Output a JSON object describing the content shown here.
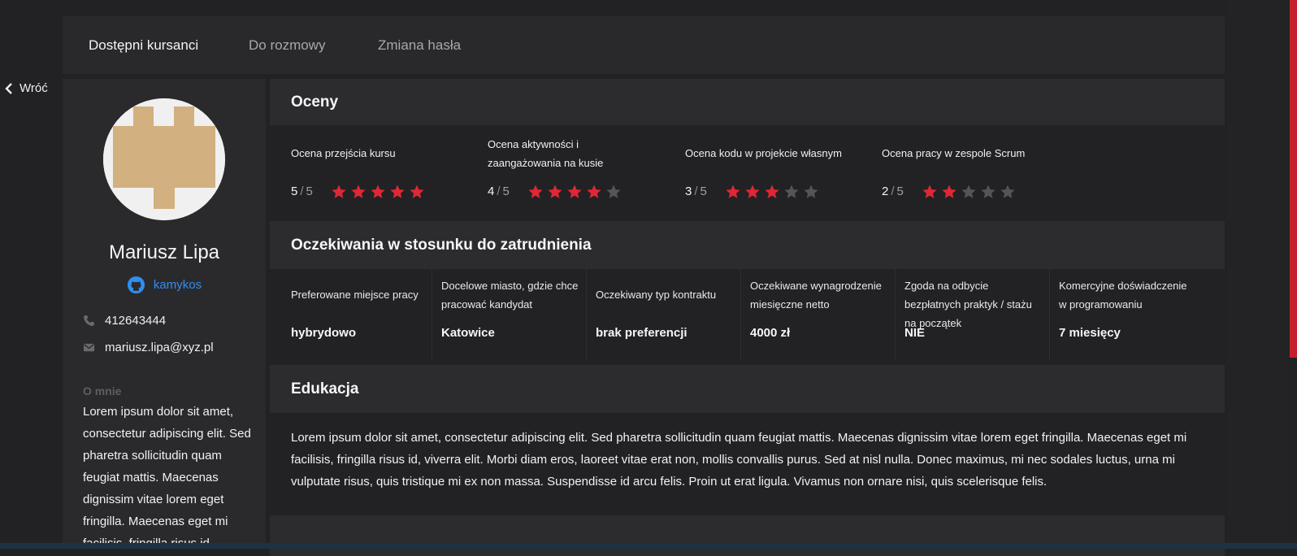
{
  "nav": {
    "tabs": [
      {
        "label": "Dostępni kursanci",
        "active": true
      },
      {
        "label": "Do rozmowy",
        "active": false
      },
      {
        "label": "Zmiana hasła",
        "active": false
      }
    ]
  },
  "back": {
    "label": "Wróć",
    "icon": "chevron-left-icon"
  },
  "profile": {
    "name": "Mariusz Lipa",
    "github": {
      "icon": "github-icon",
      "login": "kamykos"
    },
    "phone": {
      "icon": "phone-icon",
      "value": "412643444"
    },
    "email": {
      "icon": "envelope-icon",
      "value": "mariusz.lipa@xyz.pl"
    },
    "about_title": "O mnie",
    "about_text": "Lorem ipsum dolor sit amet, consectetur adipiscing elit. Sed pharetra sollicitudin quam feugiat mattis. Maecenas dignissim vitae lorem eget fringilla. Maecenas eget mi facilisis, fringilla risus id"
  },
  "ratings": {
    "title": "Oceny",
    "items": [
      {
        "label": "Ocena przejścia kursu",
        "score": "5",
        "max": "5",
        "value": 5
      },
      {
        "label": "Ocena aktywności i zaangażowania na kusie",
        "score": "4",
        "max": "5",
        "value": 4
      },
      {
        "label": "Ocena kodu w projekcie własnym",
        "score": "3",
        "max": "5",
        "value": 3
      },
      {
        "label": "Ocena pracy w zespole Scrum",
        "score": "2",
        "max": "5",
        "value": 2
      }
    ]
  },
  "expectations": {
    "title": "Oczekiwania w stosunku do zatrudnienia",
    "items": [
      {
        "label": "Preferowane miejsce pracy",
        "value": "hybrydowo"
      },
      {
        "label": "Docelowe miasto, gdzie chce pracować kandydat",
        "value": "Katowice"
      },
      {
        "label": "Oczekiwany typ kontraktu",
        "value": "brak preferencji"
      },
      {
        "label": "Oczekiwane wynagrodzenie miesięczne netto",
        "value": "4000 zł"
      },
      {
        "label": "Zgoda na odbycie bezpłatnych praktyk / stażu na początek",
        "value": "NIE"
      },
      {
        "label": "Komercyjne doświadczenie w programowaniu",
        "value": "7 miesięcy"
      }
    ]
  },
  "education": {
    "title": "Edukacja",
    "text": "Lorem ipsum dolor sit amet, consectetur adipiscing elit. Sed pharetra sollicitudin quam feugiat mattis. Maecenas dignissim vitae lorem eget fringilla. Maecenas eget mi facilisis, fringilla risus id, viverra elit. Morbi diam eros, laoreet vitae erat non, mollis convallis purus. Sed at nisl nulla. Donec maximus, mi nec sodales luctus, urna mi vulputate risus, quis tristique mi ex non massa. Suspendisse id arcu felis. Proin ut erat ligula. Vivamus non ornare nisi, quis scelerisque felis."
  },
  "colors": {
    "accent": "#e02735",
    "star_empty": "#555558",
    "link": "#2f8ff0",
    "avatar_pattern": "#d2b080"
  }
}
